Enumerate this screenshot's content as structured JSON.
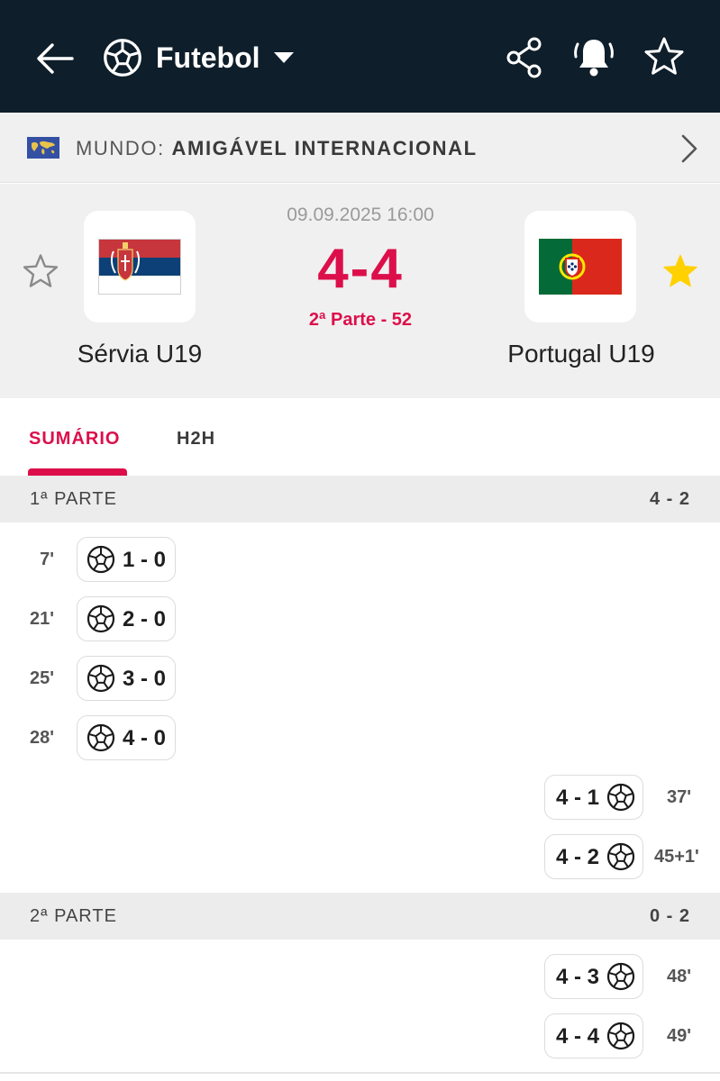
{
  "header": {
    "sport_name": "Futebol",
    "icons": [
      "back-arrow-icon",
      "soccer-ball-icon",
      "caret-down-icon",
      "share-icon",
      "bell-ringing-icon",
      "star-outline-icon"
    ]
  },
  "competition": {
    "region": "MUNDO:",
    "name": "AMIGÁVEL INTERNACIONAL",
    "flag_icon": "world-map-flag-icon"
  },
  "match": {
    "datetime": "09.09.2025 16:00",
    "score": "4-4",
    "status": "2ª Parte - 52",
    "home": {
      "name": "Sérvia U19",
      "favorite": false,
      "flag": "serbia-flag"
    },
    "away": {
      "name": "Portugal U19",
      "favorite": true,
      "flag": "portugal-flag"
    },
    "colors": {
      "live": "#dc0f4b",
      "favorite_star": "#ffd100"
    }
  },
  "tabs": [
    {
      "label": "SUMÁRIO",
      "active": true
    },
    {
      "label": "H2H",
      "active": false
    }
  ],
  "periods": [
    {
      "name": "1ª PARTE",
      "score": "4 - 2",
      "events": [
        {
          "team": "home",
          "minute": "7'",
          "score": "1 - 0",
          "type": "goal"
        },
        {
          "team": "home",
          "minute": "21'",
          "score": "2 - 0",
          "type": "goal"
        },
        {
          "team": "home",
          "minute": "25'",
          "score": "3 - 0",
          "type": "goal"
        },
        {
          "team": "home",
          "minute": "28'",
          "score": "4 - 0",
          "type": "goal"
        },
        {
          "team": "away",
          "minute": "37'",
          "score": "4 - 1",
          "type": "goal"
        },
        {
          "team": "away",
          "minute": "45+1'",
          "score": "4 - 2",
          "type": "goal"
        }
      ]
    },
    {
      "name": "2ª PARTE",
      "score": "0 - 2",
      "events": [
        {
          "team": "away",
          "minute": "48'",
          "score": "4 - 3",
          "type": "goal"
        },
        {
          "team": "away",
          "minute": "49'",
          "score": "4 - 4",
          "type": "goal"
        }
      ]
    }
  ]
}
